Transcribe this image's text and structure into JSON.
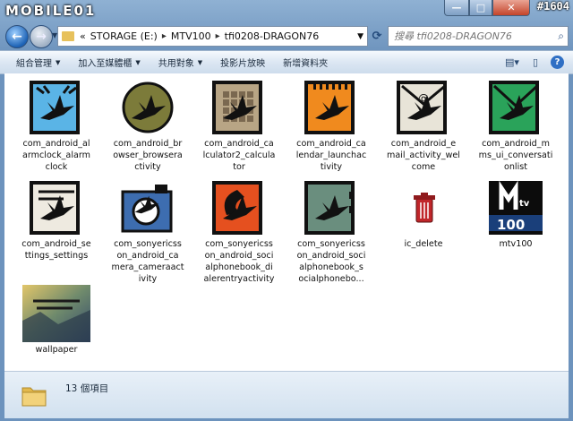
{
  "window": {
    "watermark": "MOBILE01",
    "watermark_tag": "#1604",
    "caption_min": "—",
    "caption_max": "□",
    "caption_close": "✕"
  },
  "nav": {
    "back": "←",
    "forward": "→",
    "breadcrumb": [
      "«",
      "STORAGE (E:)",
      "MTV100",
      "tfi0208-DRAGON76"
    ],
    "search_placeholder": "搜尋 tfi0208-DRAGON76",
    "refresh": "⟳"
  },
  "toolbar": {
    "items": [
      {
        "label": "組合管理",
        "dropdown": true
      },
      {
        "label": "加入至媒體櫃",
        "dropdown": true
      },
      {
        "label": "共用對象",
        "dropdown": true
      },
      {
        "label": "投影片放映",
        "dropdown": false
      },
      {
        "label": "新增資料夾",
        "dropdown": false
      }
    ],
    "help": "?"
  },
  "files": [
    {
      "name": "com_android_alarmclock_alarmclock",
      "lines": [
        "com_android_al",
        "armclock_alarm",
        "clock"
      ],
      "icon": "alarm-clock-crane-icon",
      "bg": "#5ab4e6"
    },
    {
      "name": "com_android_browser_browseractivity",
      "lines": [
        "com_android_br",
        "owser_browsera",
        "ctivity"
      ],
      "icon": "browser-crane-icon",
      "bg": "#7c7b3a"
    },
    {
      "name": "com_android_calculator2_calculator",
      "lines": [
        "com_android_ca",
        "lculator2_calcula",
        "tor"
      ],
      "icon": "calculator-crane-icon",
      "bg": "#b8a585"
    },
    {
      "name": "com_android_calendar_launchactivity",
      "lines": [
        "com_android_ca",
        "lendar_launchac",
        "tivity"
      ],
      "icon": "calendar-crane-icon",
      "bg": "#f08a1e"
    },
    {
      "name": "com_android_email_activity_welcome",
      "lines": [
        "com_android_e",
        "mail_activity_wel",
        "come"
      ],
      "icon": "email-crane-icon",
      "bg": "#e8e4d8"
    },
    {
      "name": "com_android_mms_ui_conversationlist",
      "lines": [
        "com_android_m",
        "ms_ui_conversati",
        "onlist"
      ],
      "icon": "messaging-crane-icon",
      "bg": "#2aa35a"
    },
    {
      "name": "com_android_settings_settings",
      "lines": [
        "com_android_se",
        "ttings_settings"
      ],
      "icon": "settings-crane-icon",
      "bg": "#eeeae0"
    },
    {
      "name": "com_sonyericsson_android_camera_cameraactivity",
      "lines": [
        "com_sonyericss",
        "on_android_ca",
        "mera_cameraact",
        "ivity"
      ],
      "icon": "camera-crane-icon",
      "bg": "#3d6db0"
    },
    {
      "name": "com_sonyericsson_android_socialphonebook_dialerentryactivity",
      "lines": [
        "com_sonyericss",
        "on_android_soci",
        "alphonebook_di",
        "alerentryactivity"
      ],
      "icon": "dialer-crane-icon",
      "bg": "#e5501f"
    },
    {
      "name": "com_sonyericsson_android_socialphonebook_socialphonebo...",
      "lines": [
        "com_sonyericss",
        "on_android_soci",
        "alphonebook_s",
        "ocialphonebo..."
      ],
      "icon": "phonebook-crane-icon",
      "bg": "#6a8e7e"
    },
    {
      "name": "ic_delete",
      "lines": [
        "ic_delete"
      ],
      "icon": "trash-icon",
      "bg": "#c0262a"
    },
    {
      "name": "mtv100",
      "lines": [
        "mtv100"
      ],
      "icon": "mtv-logo-icon",
      "bg": "#1a3f7a"
    },
    {
      "name": "wallpaper",
      "lines": [
        "wallpaper"
      ],
      "icon": "wallpaper-thumbnail",
      "bg": "#8a8f6a"
    }
  ],
  "status": {
    "count_text": "13 個項目"
  }
}
